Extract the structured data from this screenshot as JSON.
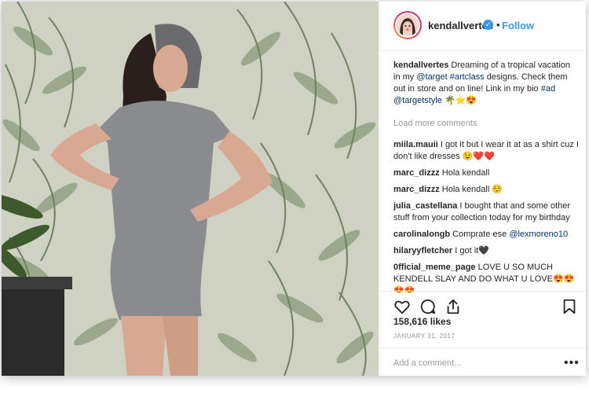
{
  "header": {
    "username": "kendallvertes",
    "verified_icon": "verified-badge-icon",
    "separator": "•",
    "follow_label": "Follow"
  },
  "caption": {
    "username": "kendallvertes",
    "text_1": " Dreaming of a tropical vacation in my ",
    "mention_1": "@target",
    "space": " ",
    "hashtag_1": "#artclass",
    "text_2": " designs. Check them out in store and on line! Link in my bio ",
    "hashtag_2": "#ad",
    "mention_2": "@targetstyle",
    "emoji": " 🌴⭐😍"
  },
  "load_more": "Load more comments",
  "comments": [
    {
      "user": "miila.mauii",
      "text": " I got it but I wear it at as a shirt cuz I don't like dresses 😉❤️❤️"
    },
    {
      "user": "marc_dizzz",
      "text": " Hola kendall"
    },
    {
      "user": "marc_dizzz",
      "text": " Hola kendall ☺️"
    },
    {
      "user": "julia_castellana",
      "text": " I bought that and some other stuff from your collection today for my birthday"
    },
    {
      "user": "carolinalongb",
      "text": " Comprate ese ",
      "mention": "@lexmoreno10"
    },
    {
      "user": "hilaryyfletcher",
      "text": " I got it🖤"
    },
    {
      "user": "0fficial_meme_page",
      "text": " LOVE U SO MUCH KENDELL SLAY AND DO WHAT U LOVE😍😍😍😍"
    }
  ],
  "actions": {
    "like_icon": "heart-icon",
    "comment_icon": "comment-bubble-icon",
    "share_icon": "share-icon",
    "save_icon": "bookmark-icon"
  },
  "likes": "158,616 likes",
  "date": "JANUARY 31, 2017",
  "add_comment_placeholder": "Add a comment...",
  "more_options": "•••",
  "colors": {
    "link_blue": "#3897f0",
    "mention_navy": "#003569",
    "muted_gray": "#999999"
  }
}
